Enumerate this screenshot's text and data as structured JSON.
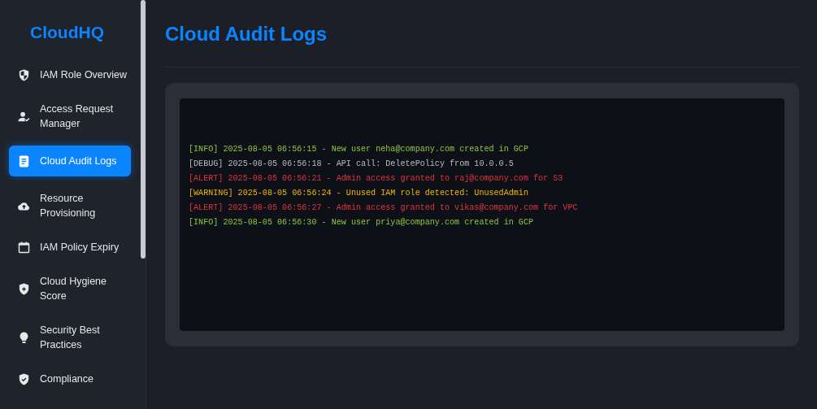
{
  "sidebar": {
    "logo": "CloudHQ",
    "items": [
      {
        "label": "IAM Role Overview",
        "selected": false
      },
      {
        "label": "Access Request Manager",
        "selected": false
      },
      {
        "label": "Cloud Audit Logs",
        "selected": true
      },
      {
        "label": "Resource Provisioning",
        "selected": false
      },
      {
        "label": "IAM Policy Expiry",
        "selected": false
      },
      {
        "label": "Cloud Hygiene Score",
        "selected": false
      },
      {
        "label": "Security Best Practices",
        "selected": false
      },
      {
        "label": "Compliance",
        "selected": false
      }
    ]
  },
  "page": {
    "title": "Cloud Audit Logs"
  },
  "logs": [
    {
      "kind": "info",
      "text": "[INFO] 2025-08-05 06:56:15 - New user neha@company.com created in GCP"
    },
    {
      "kind": "debug",
      "text": "[DEBUG] 2025-08-05 06:56:18 - API call: DeletePolicy from 10.0.0.5"
    },
    {
      "kind": "alert",
      "text": "[ALERT] 2025-08-05 06:56:21 - Admin access granted to raj@company.com for S3"
    },
    {
      "kind": "warning",
      "text": "[WARNING] 2025-08-05 06:56:24 - Unused IAM role detected: UnusedAdmin"
    },
    {
      "kind": "alert",
      "text": "[ALERT] 2025-08-05 06:56:27 - Admin access granted to vikas@company.com for VPC"
    },
    {
      "kind": "info",
      "text": "[INFO] 2025-08-05 06:56:30 - New user priya@company.com created in GCP"
    }
  ]
}
